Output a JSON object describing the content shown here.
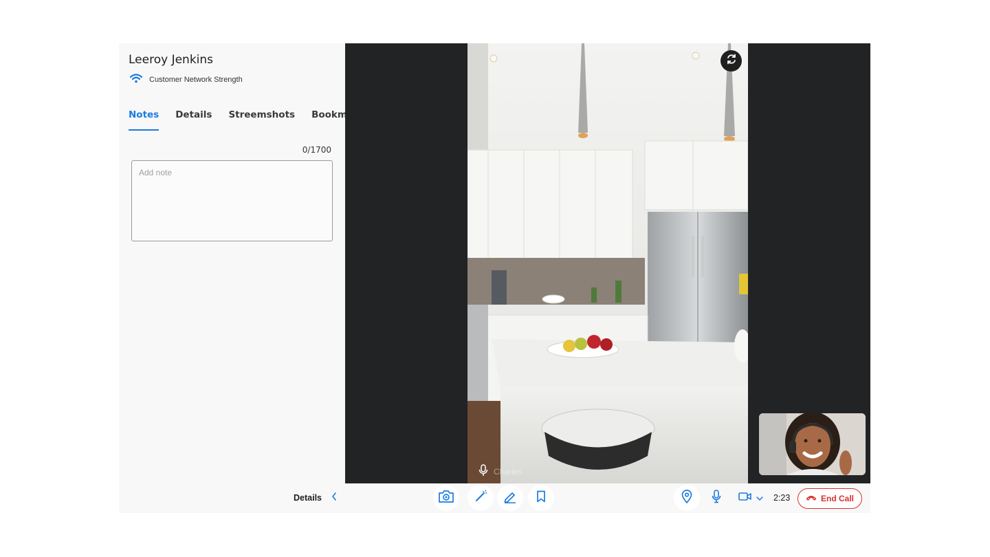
{
  "customer": {
    "name": "Leeroy Jenkins",
    "network_label": "Customer Network Strength"
  },
  "tabs": [
    {
      "label": "Notes",
      "active": true
    },
    {
      "label": "Details",
      "active": false
    },
    {
      "label": "Streemshots",
      "active": false
    },
    {
      "label": "Bookmarks",
      "active": false
    }
  ],
  "notes": {
    "counter": "0/1700",
    "placeholder": "Add note",
    "value": ""
  },
  "video": {
    "participant_name": "Charles",
    "switch_camera_icon": "camera-switch-icon"
  },
  "toolbar": {
    "details_label": "Details",
    "tools": [
      "camera-icon",
      "laser-pointer-icon",
      "pen-icon",
      "bookmark-icon"
    ],
    "timer": "2:23",
    "end_call_label": "End Call"
  },
  "colors": {
    "accent": "#1a7be0",
    "danger": "#d9302c",
    "video_bg": "#222324"
  }
}
